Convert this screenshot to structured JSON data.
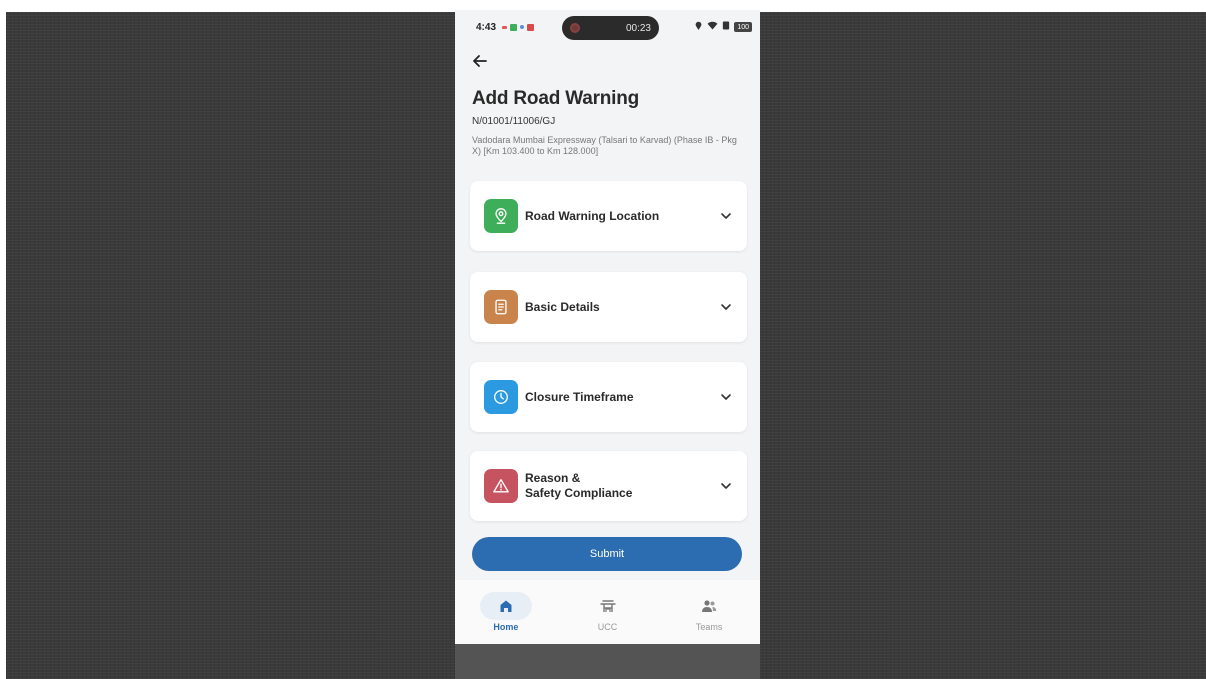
{
  "status_bar": {
    "time": "4:43",
    "recording_time": "00:23",
    "battery": "100"
  },
  "header": {
    "title": "Add Road Warning",
    "project_code": "N/01001/11006/GJ",
    "project_description": "Vadodara Mumbai Expressway (Talsari to Karvad) (Phase IB - Pkg X) [Km 103.400 to Km 128.000]"
  },
  "sections": [
    {
      "label": "Road Warning Location",
      "icon": "location-pin-icon",
      "color": "#3fae5a"
    },
    {
      "label": "Basic Details",
      "icon": "document-icon",
      "color": "#c9844b"
    },
    {
      "label": "Closure Timeframe",
      "icon": "clock-icon",
      "color": "#2b9ae0"
    },
    {
      "label": "Reason &\nSafety Compliance",
      "icon": "warning-icon",
      "color": "#c55460"
    }
  ],
  "submit_label": "Submit",
  "nav": [
    {
      "label": "Home",
      "icon": "home-icon",
      "active": true
    },
    {
      "label": "UCC",
      "icon": "ucc-icon",
      "active": false
    },
    {
      "label": "Teams",
      "icon": "teams-icon",
      "active": false
    }
  ],
  "colors": {
    "primary": "#2c6cb0",
    "background": "#f3f4f6"
  }
}
